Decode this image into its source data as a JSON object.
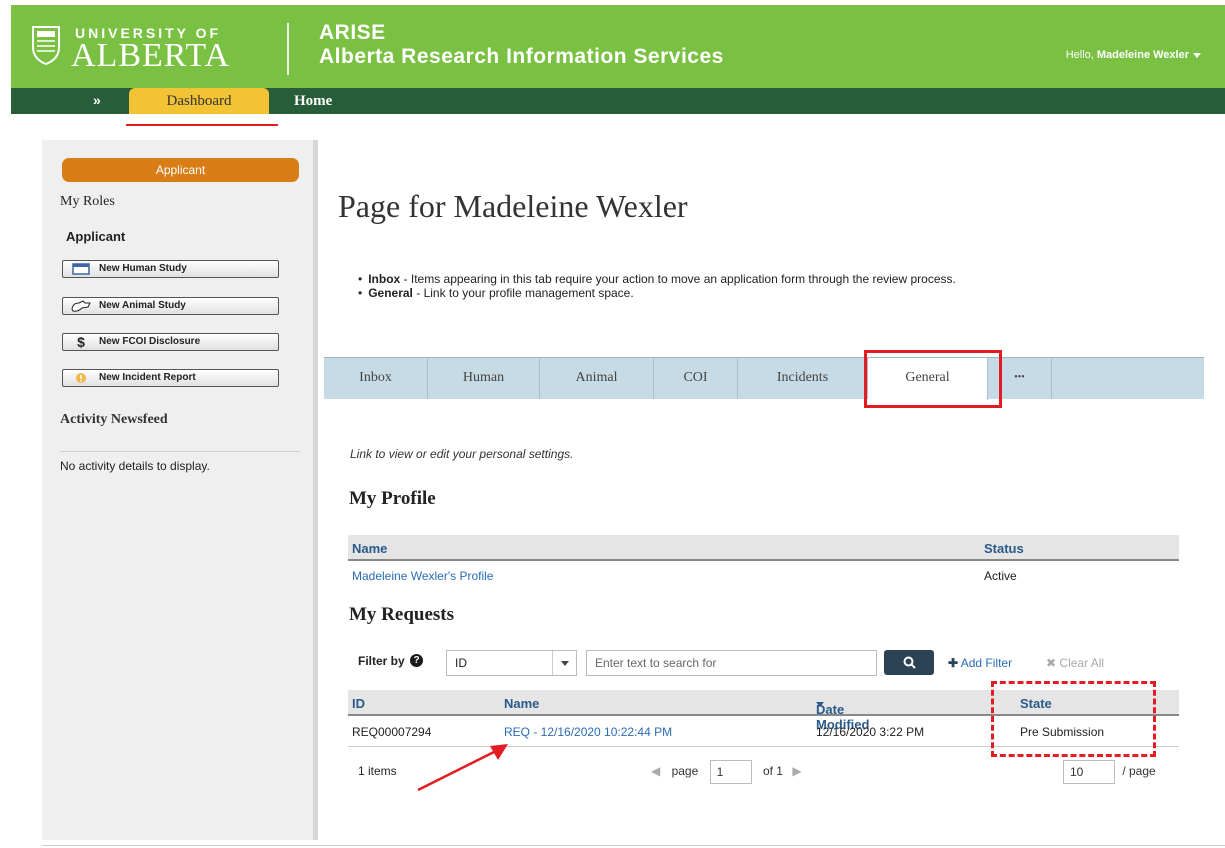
{
  "header": {
    "university_top": "UNIVERSITY OF",
    "university_main": "ALBERTA",
    "app_short": "ARISE",
    "app_full": "Alberta Research Information Services",
    "greeting_prefix": "Hello,",
    "user_name": "Madeleine Wexler"
  },
  "nav": {
    "expand": "»",
    "dashboard": "Dashboard",
    "home": "Home"
  },
  "sidebar": {
    "role_pill": "Applicant",
    "my_roles": "My Roles",
    "applicant": "Applicant",
    "buttons": [
      {
        "label": "New Human Study",
        "icon": "window-icon"
      },
      {
        "label": "New Animal Study",
        "icon": "animal-icon"
      },
      {
        "label": "New FCOI Disclosure",
        "icon": "dollar-icon"
      },
      {
        "label": "New Incident Report",
        "icon": "incident-icon"
      }
    ],
    "activity_title": "Activity Newsfeed",
    "activity_empty": "No activity details to display."
  },
  "main": {
    "page_title": "Page for Madeleine Wexler",
    "bullets": [
      {
        "term": "Inbox",
        "text": " - Items appearing in this tab require your action to move an application form through the review process."
      },
      {
        "term": "General",
        "text": " - Link to your profile management space."
      }
    ],
    "tabs": [
      "Inbox",
      "Human",
      "Animal",
      "COI",
      "Incidents",
      "General",
      "•••"
    ],
    "active_tab": "General",
    "link_note": "Link to view or edit your personal settings.",
    "profile": {
      "title": "My Profile",
      "columns": [
        "Name",
        "Status"
      ],
      "rows": [
        {
          "name": "Madeleine Wexler's Profile",
          "status": "Active"
        }
      ]
    },
    "requests": {
      "title": "My Requests",
      "filter_label": "Filter by",
      "filter_field": "ID",
      "search_placeholder": "Enter text to search for",
      "add_filter": "Add Filter",
      "clear_all": "Clear All",
      "columns": [
        "ID",
        "Name",
        "Date Modified",
        "State"
      ],
      "rows": [
        {
          "id": "REQ00007294",
          "name": "REQ - 12/16/2020 10:22:44 PM",
          "date": "12/16/2020 3:22 PM",
          "state": "Pre Submission"
        }
      ],
      "item_count": "1 items",
      "page_label": "page",
      "page_value": "1",
      "page_of": "of 1",
      "per_page_value": "10",
      "per_page_label": "/ page"
    }
  },
  "colors": {
    "header_green": "#7ac143",
    "nav_green": "#275d38",
    "dashboard_tab": "#f2c335",
    "role_orange": "#d97d17",
    "annotation_red": "#e31b23",
    "link_blue": "#2a6cb5"
  }
}
